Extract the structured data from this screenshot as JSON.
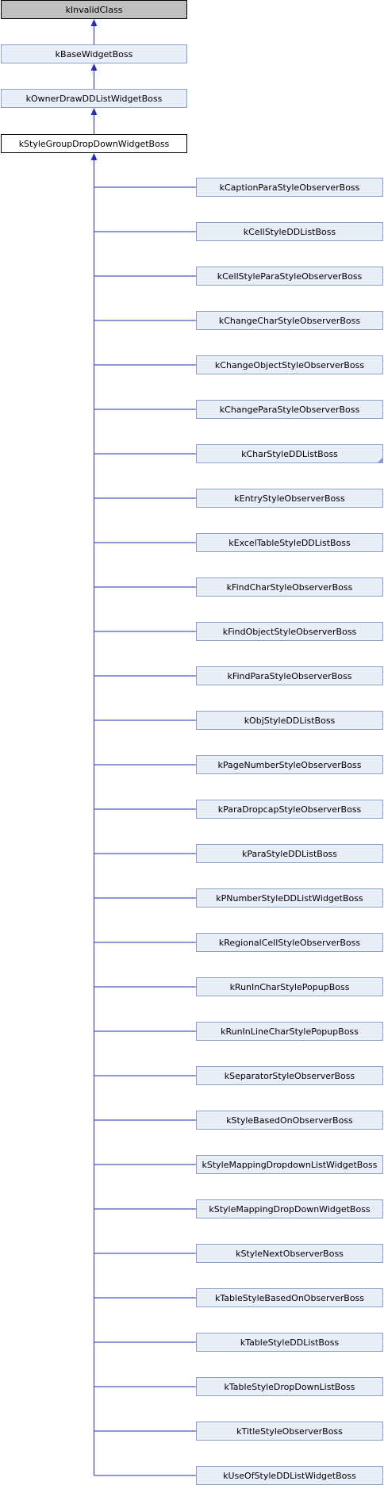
{
  "colors": {
    "edge": "#2b2bbb",
    "node_fill": "#e8eef8",
    "node_border": "#8d9ccf",
    "root_fill": "#bfbfbf",
    "root_border": "#000000",
    "current_fill": "#ffffff",
    "current_border": "#000000"
  },
  "chain": [
    {
      "label": "kInvalidClass",
      "style": "root"
    },
    {
      "label": "kBaseWidgetBoss",
      "style": "normal"
    },
    {
      "label": "kOwnerDrawDDListWidgetBoss",
      "style": "normal"
    },
    {
      "label": "kStyleGroupDropDownWidgetBoss",
      "style": "current"
    }
  ],
  "children": [
    {
      "label": "kCaptionParaStyleObserverBoss"
    },
    {
      "label": "kCellStyleDDListBoss"
    },
    {
      "label": "kCellStyleParaStyleObserverBoss"
    },
    {
      "label": "kChangeCharStyleObserverBoss"
    },
    {
      "label": "kChangeObjectStyleObserverBoss"
    },
    {
      "label": "kChangeParaStyleObserverBoss"
    },
    {
      "label": "kCharStyleDDListBoss",
      "folded": true
    },
    {
      "label": "kEntryStyleObserverBoss"
    },
    {
      "label": "kExcelTableStyleDDListBoss"
    },
    {
      "label": "kFindCharStyleObserverBoss"
    },
    {
      "label": "kFindObjectStyleObserverBoss"
    },
    {
      "label": "kFindParaStyleObserverBoss"
    },
    {
      "label": "kObjStyleDDListBoss"
    },
    {
      "label": "kPageNumberStyleObserverBoss"
    },
    {
      "label": "kParaDropcapStyleObserverBoss"
    },
    {
      "label": "kParaStyleDDListBoss"
    },
    {
      "label": "kPNumberStyleDDListWidgetBoss"
    },
    {
      "label": "kRegionalCellStyleObserverBoss"
    },
    {
      "label": "kRunInCharStylePopupBoss"
    },
    {
      "label": "kRunInLineCharStylePopupBoss"
    },
    {
      "label": "kSeparatorStyleObserverBoss"
    },
    {
      "label": "kStyleBasedOnObserverBoss"
    },
    {
      "label": "kStyleMappingDropdownListWidgetBoss"
    },
    {
      "label": "kStyleMappingDropDownWidgetBoss"
    },
    {
      "label": "kStyleNextObserverBoss"
    },
    {
      "label": "kTableStyleBasedOnObserverBoss"
    },
    {
      "label": "kTableStyleDDListBoss"
    },
    {
      "label": "kTableStyleDropDownListBoss"
    },
    {
      "label": "kTitleStyleObserverBoss"
    },
    {
      "label": "kUseOfStyleDDListWidgetBoss"
    }
  ]
}
